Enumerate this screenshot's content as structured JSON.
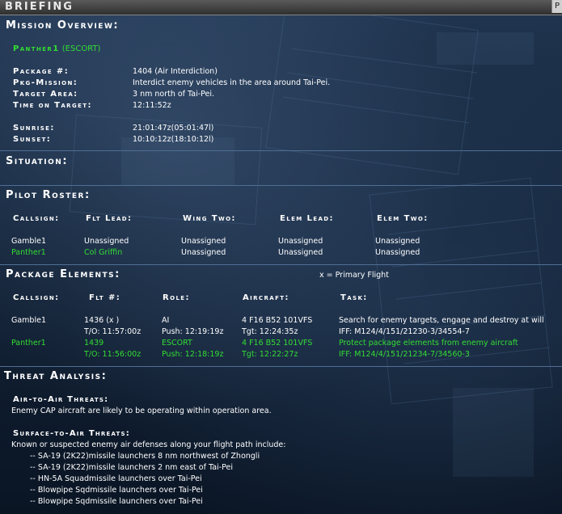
{
  "window": {
    "title": "BRIEFING",
    "close_glyph": "P"
  },
  "mission_overview": {
    "heading": "Mission Overview:",
    "flight": "Panther1",
    "flight_role": "(ESCORT)",
    "fields": [
      {
        "label": "Package #:",
        "value": "1404 (Air Interdiction)"
      },
      {
        "label": "Pkg-Mission:",
        "value": "Interdict enemy vehicles in the area around Tai-Pei."
      },
      {
        "label": "Target Area:",
        "value": "3 nm north of Tai-Pei."
      },
      {
        "label": "Time on Target:",
        "value": "12:11:52z"
      }
    ],
    "sun": [
      {
        "label": "Sunrise:",
        "value": "21:01:47z(05:01:47l)"
      },
      {
        "label": "Sunset:",
        "value": "10:10:12z(18:10:12l)"
      }
    ]
  },
  "situation": {
    "heading": "Situation:"
  },
  "pilot_roster": {
    "heading": "Pilot Roster:",
    "columns": [
      "Callsign:",
      "Flt Lead:",
      "Wing Two:",
      "Elem Lead:",
      "Elem Two:"
    ],
    "rows": [
      {
        "cells": [
          "Gamble1",
          "Unassigned",
          "Unassigned",
          "Unassigned",
          "Unassigned"
        ],
        "highlight": false
      },
      {
        "cells": [
          "Panther1",
          "Col Griffin",
          "Unassigned",
          "Unassigned",
          "Unassigned"
        ],
        "highlight": true
      }
    ]
  },
  "package_elements": {
    "heading": "Package Elements:",
    "legend": "x  = Primary Flight",
    "columns": [
      "Callsign:",
      "Flt #:",
      "Role:",
      "Aircraft:",
      "Task:"
    ],
    "rows": [
      {
        "highlight": false,
        "line1": [
          "Gamble1",
          "1436 (x )",
          "AI",
          "4 F16 B52 101VFS",
          "Search for enemy targets, engage and destroy at will"
        ],
        "line2": [
          "",
          "T/O: 11:57:00z",
          "Push: 12:19:19z",
          "Tgt: 12:24:35z",
          "IFF: M124/4/151/21230-3/34554-7"
        ]
      },
      {
        "highlight": true,
        "line1": [
          "Panther1",
          "1439",
          "ESCORT",
          "4 F16 B52 101VFS",
          "Protect package elements from enemy aircraft"
        ],
        "line2": [
          "",
          "T/O: 11:56:00z",
          "Push: 12:18:19z",
          "Tgt: 12:22:27z",
          "IFF: M124/4/151/21234-7/34560-3"
        ]
      }
    ]
  },
  "threat_analysis": {
    "heading": "Threat Analysis:",
    "air_heading": "Air-to-Air Threats:",
    "air_text": "Enemy CAP aircraft are likely to be operating within operation area.",
    "sam_heading": "Surface-to-Air Threats:",
    "sam_intro": "Known or suspected enemy air defenses along your flight path include:",
    "sam_items": [
      "-- SA-19 (2K22)missile launchers 8 nm northwest of Zhongli",
      "-- SA-19 (2K22)missile launchers 2 nm east of Tai-Pei",
      "-- HN-5A Squadmissile launchers over Tai-Pei",
      "-- Blowpipe Sqdmissile launchers over Tai-Pei",
      "-- Blowpipe Sqdmissile launchers over Tai-Pei"
    ]
  },
  "colors": {
    "highlight": "#33dd33",
    "text": "#ffffff",
    "separator": "#4f6f95"
  }
}
